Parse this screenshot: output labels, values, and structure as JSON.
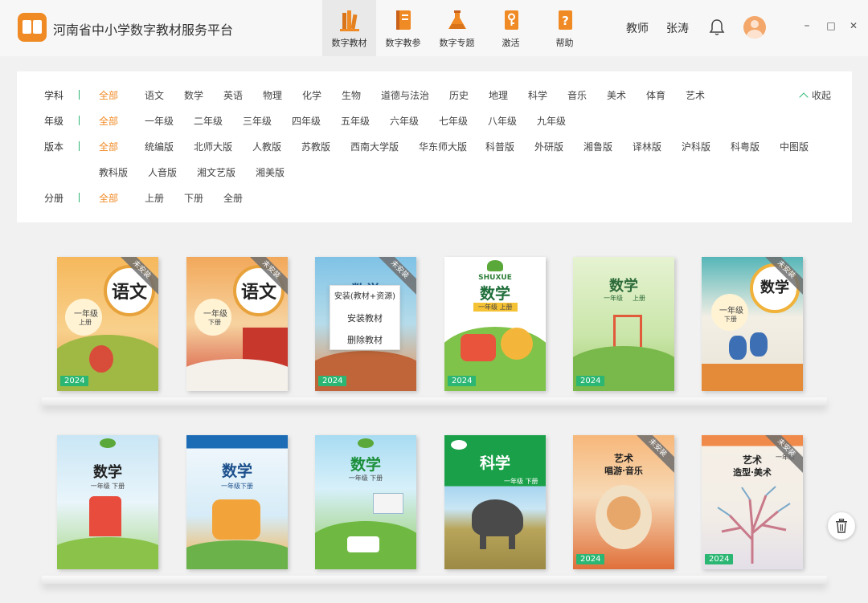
{
  "app": {
    "title": "河南省中小学数字教材服务平台",
    "logo_icon": "book-open-icon",
    "accent_color": "#f08a24",
    "active_tag_color": "#2bb673"
  },
  "nav": {
    "tabs": [
      {
        "label": "数字教材",
        "icon": "books-icon",
        "active": true
      },
      {
        "label": "数字教参",
        "icon": "notebook-icon",
        "active": false
      },
      {
        "label": "数字专题",
        "icon": "flask-icon",
        "active": false
      },
      {
        "label": "激活",
        "icon": "key-book-icon",
        "active": false
      },
      {
        "label": "帮助",
        "icon": "question-book-icon",
        "active": false
      }
    ]
  },
  "user": {
    "role": "教师",
    "name": "张涛"
  },
  "window": {
    "minimize": "–",
    "maximize": "□",
    "close": "✕"
  },
  "filters": {
    "collapse_label": "收起",
    "rows": [
      {
        "label": "学科",
        "options": [
          "全部",
          "语文",
          "数学",
          "英语",
          "物理",
          "化学",
          "生物",
          "道德与法治",
          "历史",
          "地理",
          "科学",
          "音乐",
          "美术",
          "体育",
          "艺术"
        ],
        "selected": "全部"
      },
      {
        "label": "年级",
        "options": [
          "全部",
          "一年级",
          "二年级",
          "三年级",
          "四年级",
          "五年级",
          "六年级",
          "七年级",
          "八年级",
          "九年级"
        ],
        "selected": "全部"
      },
      {
        "label": "版本",
        "options": [
          "全部",
          "统编版",
          "北师大版",
          "人教版",
          "苏教版",
          "西南大学版",
          "华东师大版",
          "科普版",
          "外研版",
          "湘鲁版",
          "译林版",
          "沪科版",
          "科粤版",
          "中图版"
        ],
        "selected": "全部"
      },
      {
        "label": "",
        "options": [
          "教科版",
          "人音版",
          "湘文艺版",
          "湘美版"
        ],
        "selected": ""
      },
      {
        "label": "分册",
        "options": [
          "全部",
          "上册",
          "下册",
          "全册"
        ],
        "selected": "全部"
      }
    ]
  },
  "books": [
    {
      "title": "语文",
      "grade": "一年级",
      "volume": "上册",
      "year": "2024",
      "badge": "未安装"
    },
    {
      "title": "语文",
      "grade": "一年级",
      "volume": "下册",
      "year": "",
      "badge": "未安装"
    },
    {
      "title": "数学",
      "grade": "",
      "volume": "",
      "year": "2024",
      "badge": "未安装"
    },
    {
      "title": "数学",
      "pinyin": "SHUXUE",
      "grade": "一年级 上册",
      "volume": "",
      "year": "2024",
      "badge": ""
    },
    {
      "title": "数学",
      "grade": "一年级",
      "volume": "上册",
      "year": "2024",
      "badge": ""
    },
    {
      "title": "数学",
      "grade": "一年级",
      "volume": "下册",
      "year": "",
      "badge": "未安装"
    },
    {
      "title": "数学",
      "grade": "一年级 下册",
      "volume": "",
      "year": "",
      "badge": ""
    },
    {
      "title": "数学",
      "grade": "一年级下册",
      "volume": "",
      "year": "",
      "badge": ""
    },
    {
      "title": "数学",
      "grade": "一年级 下册",
      "volume": "",
      "year": "",
      "badge": ""
    },
    {
      "title": "科学",
      "grade": "一年级 下册",
      "volume": "",
      "year": "",
      "badge": ""
    },
    {
      "title": "艺术",
      "subtitle": "唱游·音乐",
      "grade": "",
      "volume": "",
      "year": "2024",
      "badge": "未安装"
    },
    {
      "title": "艺术",
      "subtitle": "造型·美术",
      "grade": "一年级",
      "volume": "",
      "year": "2024",
      "badge": "未安装"
    }
  ],
  "context_menu": {
    "items": [
      "安装(教材+资源)",
      "安装教材",
      "删除教材"
    ]
  },
  "trash_icon": "trash-icon"
}
